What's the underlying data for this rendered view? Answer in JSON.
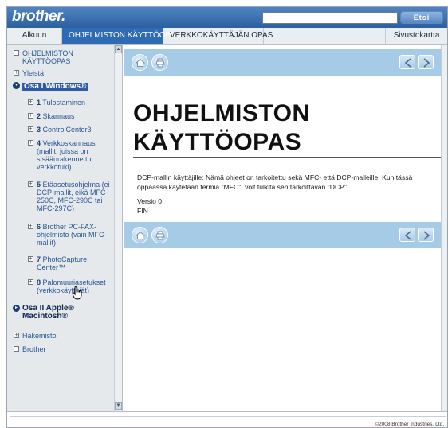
{
  "header": {
    "logo": "brother.",
    "search_placeholder": "",
    "search_button": "Etsi"
  },
  "tabs": [
    {
      "label": "Alkuun",
      "active": false
    },
    {
      "label": "OHJELMISTON KÄYTTÖOPAS",
      "active": true
    },
    {
      "label": "VERKKOKÄYTTÄJÄN OPAS",
      "active": false
    },
    {
      "label": "Sivustokartta",
      "active": false
    }
  ],
  "sidebar": {
    "items": [
      {
        "marker": "□",
        "label": "OHJELMISTON KÄYTTÖOPAS"
      },
      {
        "marker": "⊞",
        "label": "Yleistä"
      },
      {
        "marker": "●",
        "label": "Osa I Windows®"
      },
      {
        "marker": "⊞",
        "num": "1",
        "label": "Tulostaminen"
      },
      {
        "marker": "⊞",
        "num": "2",
        "label": "Skannaus"
      },
      {
        "marker": "⊞",
        "num": "3",
        "label": "ControlCenter3"
      },
      {
        "marker": "⊞",
        "num": "4",
        "label": "Verkkoskannaus (mallit, joissa on sisäänrakennettu verkkotuki)"
      },
      {
        "marker": "⊞",
        "num": "5",
        "label": "Etäasetusohjelma (ei DCP-mallit, eikä MFC-250C, MFC-290C tai MFC-297C)"
      },
      {
        "marker": "⊞",
        "num": "6",
        "label": "Brother PC-FAX-ohjelmisto (vain MFC-mallit)"
      },
      {
        "marker": "⊞",
        "num": "7",
        "label": "PhotoCapture Center™"
      },
      {
        "marker": "⊞",
        "num": "8",
        "label": "Palomuuriasetukset (verkkokäyttäjät)"
      },
      {
        "marker": "●",
        "label": "Osa II Apple® Macintosh®"
      },
      {
        "marker": "⊞",
        "label": "Hakemisto"
      },
      {
        "marker": "□",
        "label": "Brother"
      }
    ]
  },
  "main": {
    "title_line1": "OHJELMISTON",
    "title_line2": "KÄYTTÖOPAS",
    "intro": "DCP-mallin käyttäjille: Nämä ohjeet on tarkoitettu sekä MFC- että DCP-malleille. Kun tässä oppaassa käytetään termiä \"MFC\", voit tulkita sen tarkoittavan \"DCP\".",
    "version": "Versio 0",
    "language": "FIN"
  },
  "footer": {
    "copyright": "©2008 Brother Industries, Ltd."
  },
  "colors": {
    "header_blue": "#2c5f9f",
    "active_tab": "#2e6bb3",
    "nav_bar": "#a6cbe7",
    "sidebar_bg": "#e6e9ec"
  },
  "icons": [
    "home-icon",
    "printer-icon",
    "previous-arrow-icon",
    "next-arrow-icon",
    "hand-cursor-icon"
  ]
}
